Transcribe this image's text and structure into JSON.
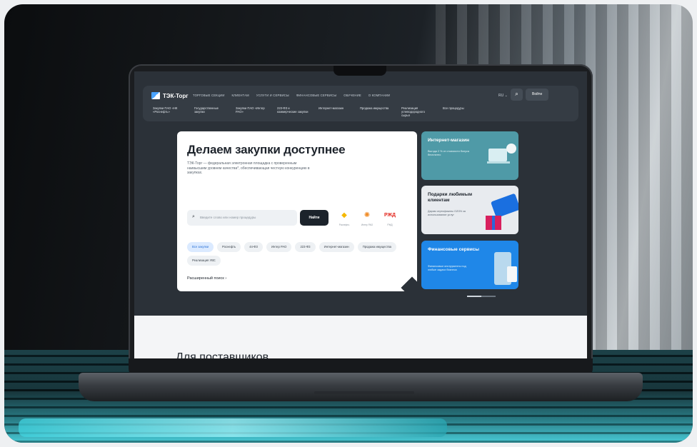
{
  "site": {
    "logo_text": "ТЭК-Торг",
    "top_nav": [
      "Торговые секции",
      "Клиентам",
      "Услуги и сервисы",
      "Финансовые сервисы",
      "Обучение",
      "О компании"
    ],
    "lang": "RU ⌄",
    "search_icon": "search-icon",
    "login_label": "Войти",
    "sub_nav": [
      "Закупки ПАО «НК «Роснефть»",
      "Государственные закупки",
      "Закупки ПАО «Интер РАО»",
      "223-ФЗ и коммерческие закупки",
      "Интернет-магазин",
      "Продажа имущества",
      "Реализация углеводородного сырья",
      "Все процедуры"
    ]
  },
  "hero": {
    "title": "Делаем закупки доступнее",
    "description": "ТЭК-Торг — федеральная электронная площадка с проверенным наивысшим уровнем качества*, обеспечивающая честную конкуренцию в закупках.",
    "search_placeholder": "Введите слово или номер процедуры",
    "find_label": "Найти",
    "partners": [
      {
        "label": "Роснефть",
        "icon": "rosneft-logo",
        "color": "#f5b800"
      },
      {
        "label": "Интер РАО",
        "icon": "inter-rao-logo",
        "color": "#f08a24"
      },
      {
        "label": "РЖД",
        "icon": "rzd-logo",
        "color": "#e2231a"
      }
    ],
    "chips": [
      "Все закупки",
      "Роснефть",
      "44-ФЗ",
      "Интер РАО",
      "223-ФЗ",
      "Интернет-магазин",
      "Продажа имущества",
      "Реализация УВС"
    ],
    "advanced_search": "Расширенный поиск  ›"
  },
  "cards": [
    {
      "title": "Интернет-магазин",
      "subtitle": "Выгода 2 % от стоимости бонуса бесплатно"
    },
    {
      "title": "Подарки любимым клиентам",
      "subtitle": "Дарим сертификаты OZON за использование услуг"
    },
    {
      "title": "Финансовые сервисы",
      "subtitle": "Финансовые инструменты под любые задачи бизнеса"
    }
  ],
  "lower": {
    "section_title": "Для поставщиков"
  },
  "colors": {
    "accent": "#1f87e8",
    "teal": "#4f9aa7",
    "dark": "#1c232b"
  }
}
